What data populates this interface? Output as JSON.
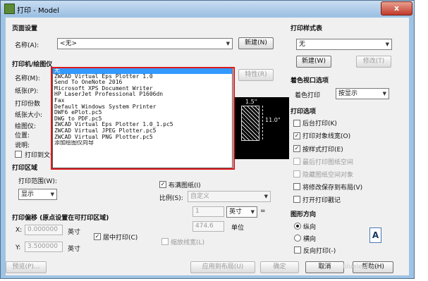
{
  "window": {
    "title": "打印 - Model",
    "close_symbol": "x"
  },
  "page_setup": {
    "group_label": "页面设置",
    "name_label": "名称(A):",
    "name_value": "<无>",
    "new_button": "新建(N)"
  },
  "printer": {
    "group_label": "打印机/绘图仪",
    "name_label": "名称(M):",
    "name_value": "无",
    "properties_button": "特性(R)",
    "paper_label": "纸张(P):",
    "copies_label": "打印份数",
    "paper_size_label": "纸张大小:",
    "plotter_label": "绘图仪:",
    "location_label": "位置:",
    "description_label": "说明:",
    "print_to_file_label": "打印到文件",
    "dropdown_items": [
      "无",
      "ZWCAD Virtual Eps Plotter 1.0",
      "Send To OneNote 2016",
      "Microsoft XPS Document Writer",
      "HP LaserJet Professional P1606dn",
      "Fax",
      "Default Windows System Printer",
      "DWF6 ePlot.pc5",
      "DWG to PDF.pc5",
      "ZWCAD Virtual Eps Plotter 1.0_1.pc5",
      "ZWCAD Virtual JPEG Plotter.pc5",
      "ZWCAD Virtual PNG Plotter.pc5",
      "添加绘图仪向导"
    ],
    "preview_dim_w": "1.5\"",
    "preview_dim_h": "11.0\""
  },
  "plot_area": {
    "group_label": "打印区域",
    "range_label": "打印范围(W):",
    "range_value": "显示"
  },
  "plot_offset": {
    "group_label": "打印偏移 (原点设置在可打印区域)",
    "x_label": "X:",
    "x_value": "0.000000",
    "y_label": "Y:",
    "y_value": "3.500000",
    "unit": "英寸",
    "center_label": "居中打印(C)"
  },
  "plot_scale": {
    "fit_label": "布满图纸(I)",
    "scale_label": "比例(S):",
    "scale_value": "自定义",
    "value1": "1",
    "unit_select": "英寸",
    "equals": "=",
    "value2": "474.6",
    "unit_label": "单位",
    "lineweight_label": "缩放线宽(L)"
  },
  "style_table": {
    "group_label": "打印样式表",
    "value": "无",
    "new_button": "新建(W)",
    "edit_button": "修改(T)"
  },
  "shaded": {
    "group_label": "着色视口选项",
    "label": "着色打印",
    "value": "按显示"
  },
  "plot_options": {
    "group_label": "打印选项",
    "items": [
      {
        "label": "后台打印(K)",
        "checked": false,
        "disabled": false
      },
      {
        "label": "打印对象线宽(O)",
        "checked": true,
        "disabled": false
      },
      {
        "label": "按样式打印(E)",
        "checked": true,
        "disabled": false
      },
      {
        "label": "最后打印图纸空间",
        "checked": false,
        "disabled": true
      },
      {
        "label": "隐藏图纸空间对象",
        "checked": false,
        "disabled": true
      },
      {
        "label": "将修改保存到布局(V)",
        "checked": false,
        "disabled": false
      },
      {
        "label": "打开打印戳记",
        "checked": false,
        "disabled": false
      }
    ]
  },
  "orientation": {
    "group_label": "图形方向",
    "portrait": "纵向",
    "landscape": "横向",
    "reverse": "反向打印(-)",
    "icon_letter": "A"
  },
  "footer": {
    "preview_button": "预览(P)...",
    "apply_button": "应用到布局(U)",
    "ok_button": "确定",
    "cancel_button": "取消",
    "help_button": "帮助(H)"
  },
  "watermark": "blueleaf.cn"
}
